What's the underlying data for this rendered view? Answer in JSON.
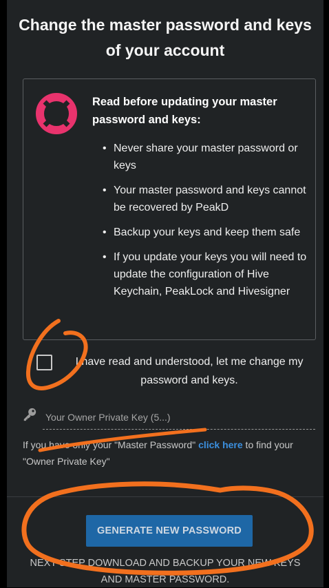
{
  "page": {
    "title": "Change the master password and keys of your account"
  },
  "notice": {
    "icon": "lifebuoy-icon",
    "icon_color": "#e8336d",
    "title": "Read before updating your master password and keys:",
    "items": [
      "Never share your master password or keys",
      "Your master password and keys cannot be recovered by PeakD",
      "Backup your keys and keep them safe",
      "If you update your keys you will need to update the configuration of Hive Keychain, PeakLock and Hivesigner"
    ]
  },
  "confirm": {
    "checked": false,
    "label": "I have read and understood, let me change my password and keys."
  },
  "owner_key": {
    "icon": "key-icon",
    "value": "",
    "placeholder": "Your Owner Private Key (5...)"
  },
  "hint": {
    "before": "If you have only your \"Master Password\" ",
    "link": "click here",
    "after": " to find your \"Owner Private Key\""
  },
  "actions": {
    "generate_label": "GENERATE NEW PASSWORD",
    "next_step": "NEXT STEP DOWNLOAD AND BACKUP YOUR NEW KEYS AND MASTER PASSWORD."
  },
  "colors": {
    "background": "#202325",
    "accent": "#1e67a6",
    "link": "#3b8fde",
    "annotation": "#f2701e"
  }
}
